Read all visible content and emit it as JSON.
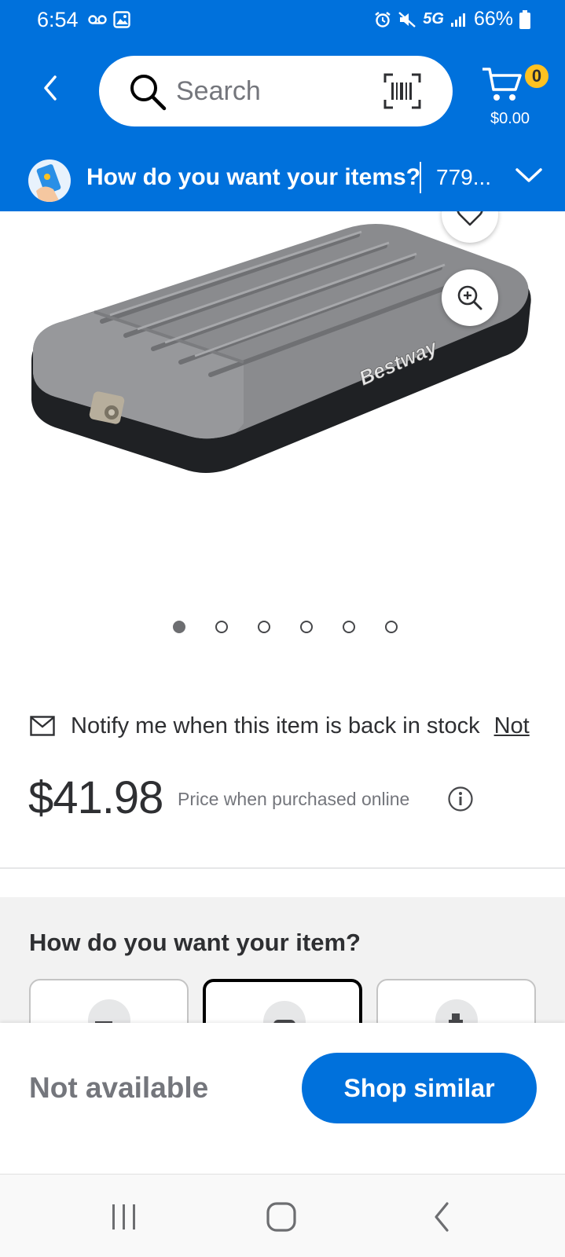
{
  "status_bar": {
    "time": "6:54",
    "network": "5G",
    "battery": "66%",
    "icons": [
      "voicemail-icon",
      "image-icon",
      "alarm-icon",
      "mute-icon",
      "signal-icon",
      "battery-icon"
    ]
  },
  "header": {
    "search": {
      "placeholder": "Search"
    },
    "cart": {
      "count": "0",
      "total": "$0.00"
    },
    "colors": {
      "brand_blue": "#0071dc",
      "badge_yellow": "#ffc220"
    }
  },
  "fulfillment_bar": {
    "title": "How do you want your items?",
    "zip": "779..."
  },
  "product": {
    "brand_on_image": "Bestway",
    "carousel": {
      "total_images": 6,
      "active_index": 0
    },
    "notify_text": "Notify me when this item is back in stock",
    "notify_link": "Not",
    "price": "$41.98",
    "price_note": "Price when purchased online"
  },
  "options": {
    "title": "How do you want your item?",
    "cards": [
      {
        "icon": "shipping-truck-icon",
        "selected": false
      },
      {
        "icon": "pickup-icon",
        "selected": true
      },
      {
        "icon": "delivery-icon",
        "selected": false
      }
    ]
  },
  "action_bar": {
    "status": "Not available",
    "button": "Shop similar"
  },
  "system_nav": [
    "recent-apps-icon",
    "home-icon",
    "back-nav-icon"
  ]
}
